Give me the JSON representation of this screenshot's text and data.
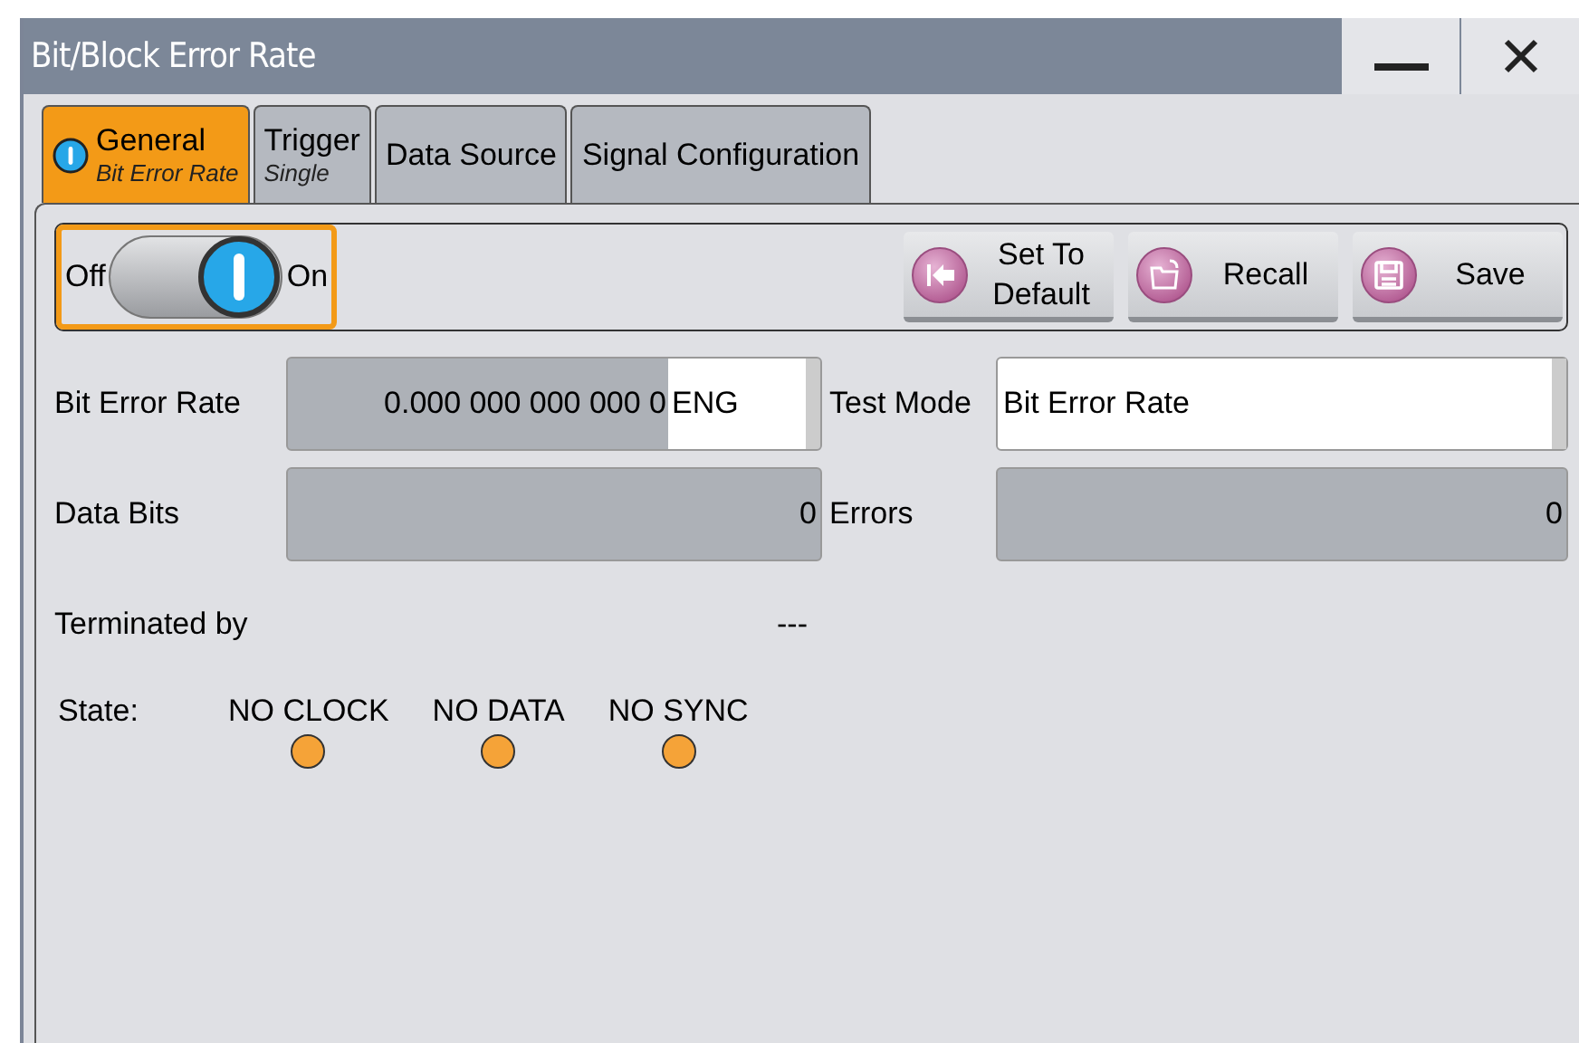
{
  "window": {
    "title": "Bit/Block Error Rate"
  },
  "tabs": [
    {
      "label": "General",
      "sublabel": "Bit Error Rate",
      "selected": true,
      "has_indicator": true
    },
    {
      "label": "Trigger",
      "sublabel": "Single",
      "selected": false
    },
    {
      "label": "Data Source",
      "selected": false
    },
    {
      "label": "Signal Configuration",
      "selected": false
    }
  ],
  "toggle": {
    "off_label": "Off",
    "on_label": "On",
    "on": true
  },
  "actions": [
    {
      "label": "Set To\nDefault",
      "kind": "default"
    },
    {
      "label": "Recall",
      "kind": "recall"
    },
    {
      "label": "Save",
      "kind": "save"
    }
  ],
  "fields": {
    "bit_error_rate": {
      "label": "Bit Error Rate",
      "value": "0.000 000 000 000 0",
      "unit": "ENG"
    },
    "test_mode": {
      "label": "Test Mode",
      "value": "Bit Error Rate"
    },
    "data_bits": {
      "label": "Data Bits",
      "value": "0"
    },
    "errors": {
      "label": "Errors",
      "value": "0"
    },
    "terminated_by": {
      "label": "Terminated by",
      "value": "---"
    }
  },
  "state": {
    "label": "State:",
    "indicators": [
      {
        "label": "NO CLOCK",
        "color": "#f5a338"
      },
      {
        "label": "NO DATA",
        "color": "#f5a338"
      },
      {
        "label": "NO SYNC",
        "color": "#f5a338"
      }
    ]
  }
}
